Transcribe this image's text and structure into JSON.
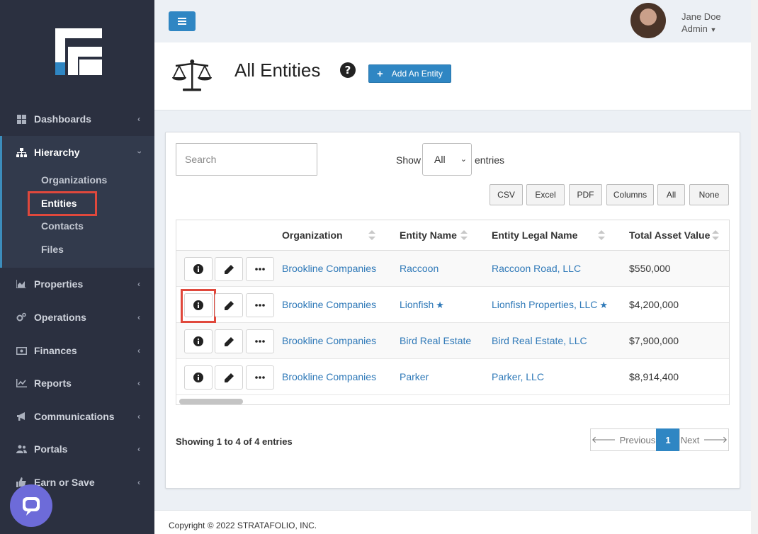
{
  "sidebar": {
    "items": [
      {
        "label": "Dashboards",
        "icon": "dashboard-icon"
      },
      {
        "label": "Hierarchy",
        "icon": "hierarchy-icon"
      },
      {
        "label": "Properties",
        "icon": "chart-area-icon"
      },
      {
        "label": "Operations",
        "icon": "cogs-icon"
      },
      {
        "label": "Finances",
        "icon": "money-icon"
      },
      {
        "label": "Reports",
        "icon": "line-chart-icon"
      },
      {
        "label": "Communications",
        "icon": "bullhorn-icon"
      },
      {
        "label": "Portals",
        "icon": "users-icon"
      },
      {
        "label": "Earn or Save",
        "icon": "thumbs-up-icon"
      }
    ],
    "hierarchy_sub": [
      "Organizations",
      "Entities",
      "Contacts",
      "Files"
    ]
  },
  "user": {
    "name": "Jane Doe",
    "role": "Admin"
  },
  "header": {
    "title": "All Entities",
    "add_button": "Add An Entity"
  },
  "controls": {
    "search_placeholder": "Search",
    "show_label": "Show",
    "show_value": "All",
    "entries_label": "entries",
    "export_buttons": [
      "CSV",
      "Excel",
      "PDF",
      "Columns",
      "All",
      "None"
    ]
  },
  "table": {
    "columns": [
      "Organization",
      "Entity Name",
      "Entity Legal Name",
      "Total Asset Value"
    ],
    "rows": [
      {
        "org": "Brookline Companies",
        "name": "Raccoon",
        "legal": "Raccoon Road, LLC",
        "value": "$550,000",
        "starred": false
      },
      {
        "org": "Brookline Companies",
        "name": "Lionfish",
        "legal": "Lionfish Properties, LLC",
        "value": "$4,200,000",
        "starred": true
      },
      {
        "org": "Brookline Companies",
        "name": "Bird Real Estate",
        "legal": "Bird Real Estate, LLC",
        "value": "$7,900,000",
        "starred": false
      },
      {
        "org": "Brookline Companies",
        "name": "Parker",
        "legal": "Parker, LLC",
        "value": "$8,914,400",
        "starred": false
      }
    ]
  },
  "pagination": {
    "summary": "Showing 1 to 4 of 4 entries",
    "previous": "Previous",
    "page": "1",
    "next": "Next"
  },
  "footer": {
    "copyright": "Copyright © 2022 STRATAFOLIO, INC."
  },
  "colors": {
    "sidebar": "#2b3040",
    "accent": "#2f86c3",
    "link": "#2f79b8",
    "highlight": "#e0483c"
  }
}
